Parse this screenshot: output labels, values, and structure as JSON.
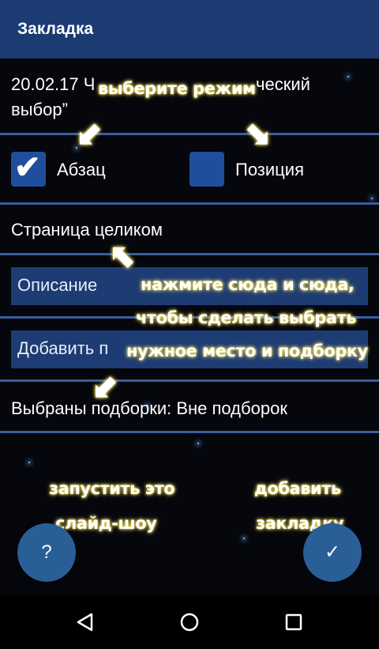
{
  "app": {
    "title": "Закладка"
  },
  "bookmark": {
    "line1": "20.02.17 Ч",
    "line1_tail": "ческий",
    "line2": "выбор”"
  },
  "options": {
    "paragraph_label": "Абзац",
    "paragraph_checked": true,
    "position_label": "Позиция",
    "position_checked": false
  },
  "page_whole": "Страница целиком",
  "fields": {
    "description_placeholder": "Описание",
    "add_placeholder": "Добавить п"
  },
  "selected": "Выбраны подборки: Вне подборок",
  "annotations": {
    "choose_mode": "выберите режим",
    "tap_here_1": "нажмите сюда и сюда,",
    "tap_here_2": "чтобы сделать выбрать",
    "tap_here_3": "нужное место и подборку",
    "slideshow_1": "запустить это",
    "slideshow_2": "слайд-шоу",
    "add_1": "добавить",
    "add_2": "закладку"
  },
  "fab": {
    "help_symbol": "?",
    "confirm_symbol": "✓"
  },
  "colors": {
    "appbar": "#1c3b73",
    "accent": "#2a5e96",
    "annotation_glow": "#ffe65a"
  }
}
